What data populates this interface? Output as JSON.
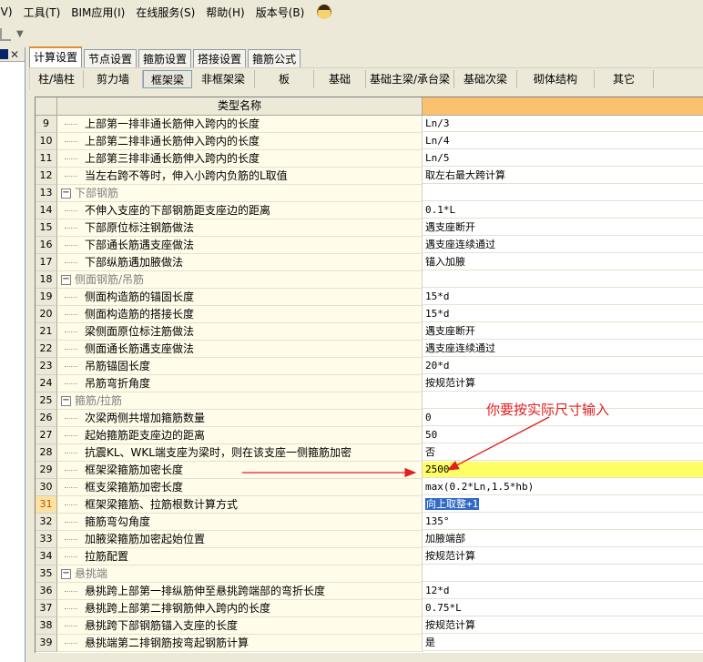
{
  "menu": [
    {
      "label": "(V)",
      "name": "menu-view"
    },
    {
      "label": "工具(T)",
      "name": "menu-tools"
    },
    {
      "label": "BIM应用(I)",
      "name": "menu-bim"
    },
    {
      "label": "在线服务(S)",
      "name": "menu-online-service"
    },
    {
      "label": "帮助(H)",
      "name": "menu-help"
    },
    {
      "label": "版本号(B)",
      "name": "menu-version"
    }
  ],
  "tabs_main": [
    "计算设置",
    "节点设置",
    "箍筋设置",
    "搭接设置",
    "箍筋公式"
  ],
  "tabs_sub": [
    "柱/墙柱",
    "剪力墙",
    "框架梁",
    "非框架梁",
    "板",
    "基础",
    "基础主梁/承台梁",
    "基础次梁",
    "砌体结构",
    "其它"
  ],
  "grid": {
    "header": "类型名称",
    "rows": [
      {
        "num": "9",
        "name": "上部第一排非通长筋伸入跨内的长度",
        "value": "Ln/3"
      },
      {
        "num": "10",
        "name": "上部第二排非通长筋伸入跨内的长度",
        "value": "Ln/4"
      },
      {
        "num": "11",
        "name": "上部第三排非通长筋伸入跨内的长度",
        "value": "Ln/5"
      },
      {
        "num": "12",
        "name": "当左右跨不等时，伸入小跨内负筋的L取值",
        "value": "取左右最大跨计算"
      },
      {
        "num": "13",
        "name": "下部钢筋",
        "value": "",
        "group": true
      },
      {
        "num": "14",
        "name": "不伸入支座的下部钢筋距支座边的距离",
        "value": "0.1*L"
      },
      {
        "num": "15",
        "name": "下部原位标注钢筋做法",
        "value": "遇支座断开"
      },
      {
        "num": "16",
        "name": "下部通长筋遇支座做法",
        "value": "遇支座连续通过"
      },
      {
        "num": "17",
        "name": "下部纵筋遇加腋做法",
        "value": "锚入加腋"
      },
      {
        "num": "18",
        "name": "侧面钢筋/吊筋",
        "value": "",
        "group": true
      },
      {
        "num": "19",
        "name": "侧面构造筋的锚固长度",
        "value": "15*d"
      },
      {
        "num": "20",
        "name": "侧面构造筋的搭接长度",
        "value": "15*d"
      },
      {
        "num": "21",
        "name": "梁侧面原位标注筋做法",
        "value": "遇支座断开"
      },
      {
        "num": "22",
        "name": "侧面通长筋遇支座做法",
        "value": "遇支座连续通过"
      },
      {
        "num": "23",
        "name": "吊筋锚固长度",
        "value": "20*d"
      },
      {
        "num": "24",
        "name": "吊筋弯折角度",
        "value": "按规范计算"
      },
      {
        "num": "25",
        "name": "箍筋/拉筋",
        "value": "",
        "group": true
      },
      {
        "num": "26",
        "name": "次梁两侧共增加箍筋数量",
        "value": "0"
      },
      {
        "num": "27",
        "name": "起始箍筋距支座边的距离",
        "value": "50"
      },
      {
        "num": "28",
        "name": "抗震KL、WKL端支座为梁时，则在该支座一侧箍筋加密",
        "value": "否"
      },
      {
        "num": "29",
        "name": "框架梁箍筋加密长度",
        "value": "2500",
        "highlight": true
      },
      {
        "num": "30",
        "name": "框支梁箍筋加密长度",
        "value": "max(0.2*Ln,1.5*hb)"
      },
      {
        "num": "31",
        "name": "框架梁箍筋、拉筋根数计算方式",
        "value": "向上取整+1",
        "current": true
      },
      {
        "num": "32",
        "name": "箍筋弯勾角度",
        "value": "135°"
      },
      {
        "num": "33",
        "name": "加腋梁箍筋加密起始位置",
        "value": "加腋端部"
      },
      {
        "num": "34",
        "name": "拉筋配置",
        "value": "按规范计算"
      },
      {
        "num": "35",
        "name": "悬挑端",
        "value": "",
        "group": true
      },
      {
        "num": "36",
        "name": "悬挑跨上部第一排纵筋伸至悬挑跨端部的弯折长度",
        "value": "12*d"
      },
      {
        "num": "37",
        "name": "悬挑跨上部第二排钢筋伸入跨内的长度",
        "value": "0.75*L"
      },
      {
        "num": "38",
        "name": "悬挑跨下部钢筋锚入支座的长度",
        "value": "按规范计算"
      },
      {
        "num": "39",
        "name": "悬挑端第二排钢筋按弯起钢筋计算",
        "value": "是"
      }
    ]
  },
  "annotation": "你要按实际尺寸输入",
  "colors": {
    "header_value_bg": "#fbc16c",
    "highlight_row": "#ffff66",
    "annotation": "#e02020",
    "selection": "#316ac5"
  },
  "icons": [
    "mascot-icon",
    "close-icon",
    "expand-minus-icon",
    "dropdown-arrow-icon"
  ]
}
